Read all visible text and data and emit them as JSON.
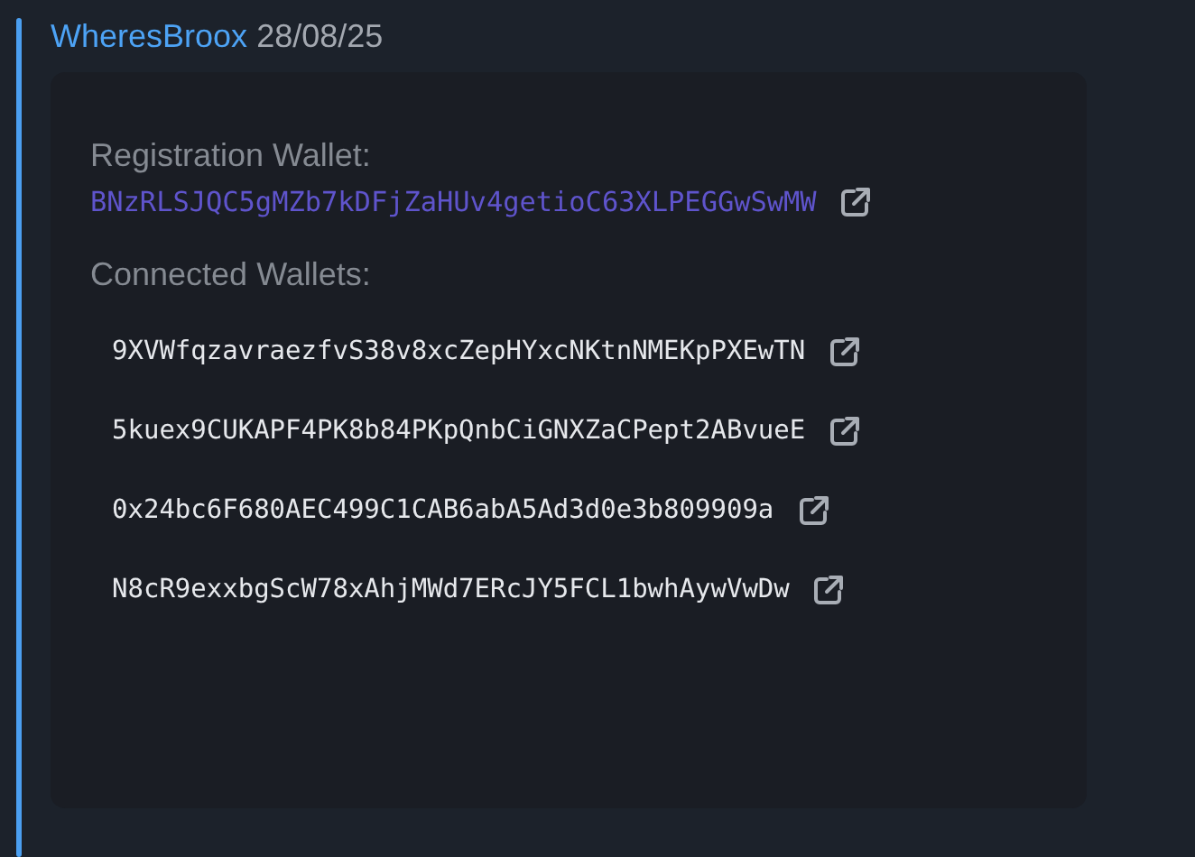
{
  "message": {
    "author": "WheresBroox",
    "date": "28/08/25"
  },
  "registration": {
    "label": "Registration Wallet:",
    "address": "BNzRLSJQC5gMZb7kDFjZaHUv4getioC63XLPEGGwSwMW"
  },
  "connected": {
    "label": "Connected Wallets:",
    "addresses": [
      "9XVWfqzavraezfvS38v8xcZepHYxcNKtnNMEKpPXEwTN",
      "5kuex9CUKAPF4PK8b84PKpQnbCiGNXZaCPept2ABvueE",
      "0x24bc6F680AEC499C1CAB6abA5Ad3d0e3b809909a",
      "N8cR9exxbgScW78xAhjMWd7ERcJY5FCL1bwhAywVwDw"
    ]
  }
}
